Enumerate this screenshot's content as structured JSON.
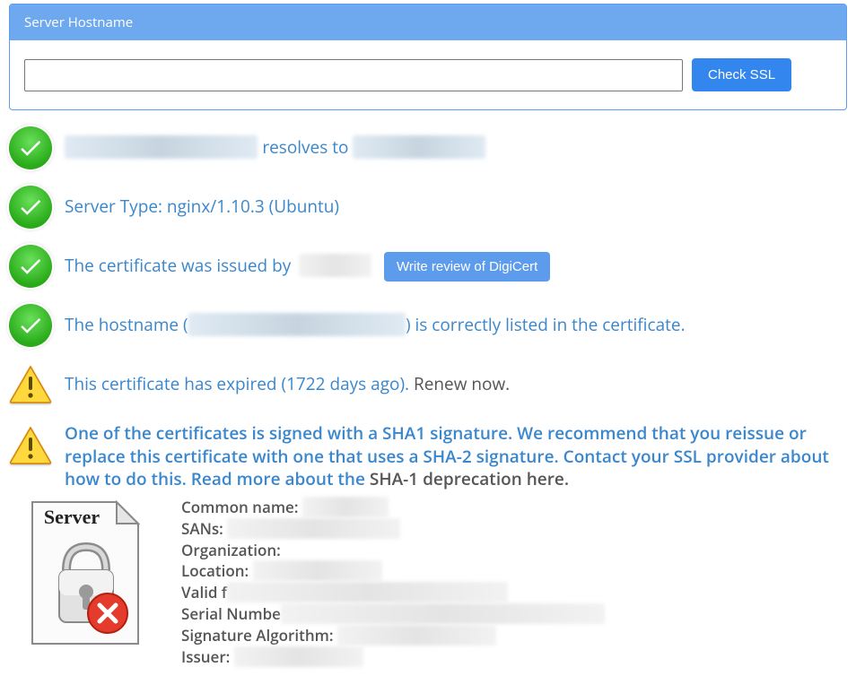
{
  "panel": {
    "heading": "Server Hostname",
    "input_value": "",
    "button": "Check SSL"
  },
  "results": {
    "resolves_hostname": "████████████████",
    "resolves_mid": " resolves to ",
    "resolves_ip": "███████████",
    "server_type": "Server Type: nginx/1.10.3 (Ubuntu)",
    "issuer_prefix": "The certificate was issued by",
    "issuer_name": "██████",
    "review_button": "Write review of DigiCert",
    "hostname_pre": "The hostname (",
    "hostname_val": "██████████████████",
    "hostname_post": ") is correctly listed in the certificate.",
    "expired_pre": "This certificate has expired (1722 days ago). ",
    "expired_link": "Renew now",
    "sha1_text": "One of the certificates is signed with a SHA1 signature. We recommend that you reissue or replace this certificate with one that uses a SHA-2 signature. Contact your SSL provider about how to do this. Read more about the ",
    "sha1_link": "SHA-1 deprecation here"
  },
  "cert": {
    "common_name_label": "Common name:",
    "common_name": "████████",
    "sans_label": "SANs:",
    "sans": "████████████████",
    "organization_label": "Organization:",
    "organization": "",
    "location_label": "Location:",
    "location": "████████████",
    "valid_label": "Valid f",
    "valid": "██████████████████████████",
    "serial_label": "Serial Numbe",
    "serial": "██████████████████████████████",
    "sigalg_label": "Signature Algorithm:",
    "sigalg": "s██████████████",
    "issuer_label": "Issuer:",
    "issuer": "████████████"
  },
  "icons": {
    "server_label": "Server"
  }
}
